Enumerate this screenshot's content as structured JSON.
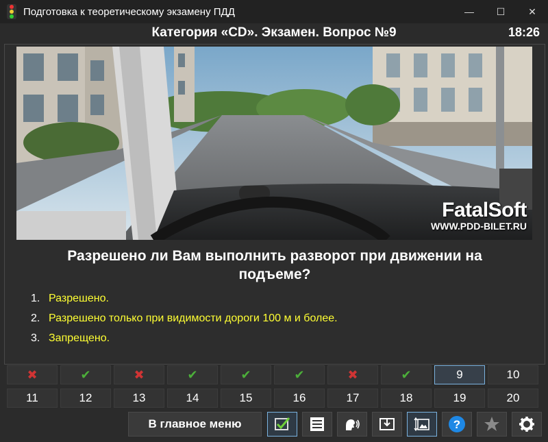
{
  "window": {
    "title": "Подготовка к теоретическому экзамену ПДД",
    "controls": {
      "minimize": "—",
      "maximize": "☐",
      "close": "✕"
    }
  },
  "header": {
    "title": "Категория «CD». Экзамен. Вопрос №9",
    "timer": "18:26"
  },
  "image": {
    "watermark_brand": "FatalSoft",
    "watermark_url": "WWW.PDD-BILET.RU"
  },
  "question": {
    "text": "Разрешено ли Вам выполнить разворот при движении на подъеме?",
    "answers": [
      {
        "num": "1.",
        "text": "Разрешено."
      },
      {
        "num": "2.",
        "text": "Разрешено только при видимости дороги 100 м и более."
      },
      {
        "num": "3.",
        "text": "Запрещено."
      }
    ]
  },
  "navigation": {
    "row1": [
      {
        "state": "wrong",
        "glyph": "✖"
      },
      {
        "state": "correct",
        "glyph": "✔"
      },
      {
        "state": "wrong",
        "glyph": "✖"
      },
      {
        "state": "correct",
        "glyph": "✔"
      },
      {
        "state": "correct",
        "glyph": "✔"
      },
      {
        "state": "correct",
        "glyph": "✔"
      },
      {
        "state": "wrong",
        "glyph": "✖"
      },
      {
        "state": "correct",
        "glyph": "✔"
      },
      {
        "state": "current",
        "label": "9"
      },
      {
        "state": "pending",
        "label": "10"
      }
    ],
    "row2": [
      "11",
      "12",
      "13",
      "14",
      "15",
      "16",
      "17",
      "18",
      "19",
      "20"
    ]
  },
  "toolbar": {
    "main_menu_label": "В главное меню",
    "buttons": [
      {
        "icon": "answer-check-icon",
        "active": true
      },
      {
        "icon": "list-icon",
        "active": false
      },
      {
        "icon": "voice-icon",
        "active": false
      },
      {
        "icon": "save-icon",
        "active": false
      },
      {
        "icon": "image-resize-icon",
        "active": true
      },
      {
        "icon": "help-icon",
        "active": false
      },
      {
        "icon": "star-icon",
        "active": false
      },
      {
        "icon": "gear-icon",
        "active": false
      }
    ]
  },
  "colors": {
    "background": "#2b2b2b",
    "answer_text": "#ffff33",
    "correct": "#4caf3a",
    "wrong": "#d03434",
    "accent": "#7bb3e0"
  }
}
